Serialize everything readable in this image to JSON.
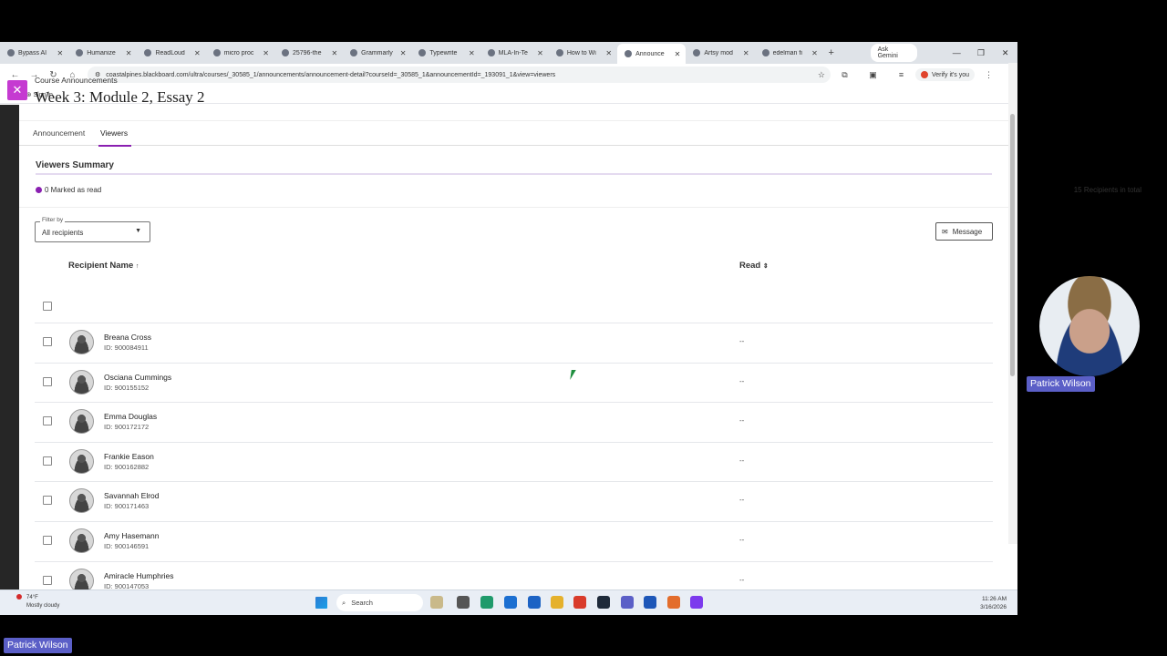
{
  "browser": {
    "tabs": [
      {
        "label": "Bypass AI",
        "active": false
      },
      {
        "label": "Humanize",
        "active": false
      },
      {
        "label": "ReadLoud",
        "active": false
      },
      {
        "label": "micro proc",
        "active": false
      },
      {
        "label": "25796-the",
        "active": false
      },
      {
        "label": "Grammarly",
        "active": false
      },
      {
        "label": "Typewrite",
        "active": false
      },
      {
        "label": "MLA-In-Te",
        "active": false
      },
      {
        "label": "How to Wi",
        "active": false
      },
      {
        "label": "Announce",
        "active": true
      },
      {
        "label": "Artsy mod",
        "active": false
      },
      {
        "label": "edelman fi",
        "active": false
      }
    ],
    "new_tab": "+",
    "gemini_label": "Ask Gemini",
    "url": "coastalpines.blackboard.com/ultra/courses/_30585_1/announcements/announcement-detail?courseId=_30585_1&announcementId=_193091_1&view=viewers",
    "verify_label": "Verify it's you",
    "bookmark_signin": "Sign in"
  },
  "page": {
    "breadcrumb": "Course Announcements",
    "title": "Week 3: Module 2, Essay 2",
    "tabs": [
      "Announcement",
      "Viewers"
    ],
    "selected_tab": "Viewers",
    "summary_title": "Viewers Summary",
    "marked_as_read": "0 Marked as read",
    "recipients_total": "15 Recipients in total",
    "filter_label": "Filter by",
    "filter_value": "All recipients",
    "message_button": "Message",
    "col_recipient": "Recipient Name",
    "col_read": "Read",
    "recipients": [
      {
        "name": "Breana Cross",
        "id": "ID: 900084911",
        "read": "--"
      },
      {
        "name": "Osciana Cummings",
        "id": "ID: 900155152",
        "read": "--"
      },
      {
        "name": "Emma Douglas",
        "id": "ID: 900172172",
        "read": "--"
      },
      {
        "name": "Frankie Eason",
        "id": "ID: 900162882",
        "read": "--"
      },
      {
        "name": "Savannah Elrod",
        "id": "ID: 900171463",
        "read": "--"
      },
      {
        "name": "Amy Hasemann",
        "id": "ID: 900146591",
        "read": "--"
      },
      {
        "name": "Amiracle Humphries",
        "id": "ID: 900147053",
        "read": "--"
      }
    ]
  },
  "taskbar": {
    "weather_temp": "74°F",
    "weather_desc": "Mostly cloudy",
    "search_label": "Search",
    "time": "11:26 AM",
    "date": "3/16/2026"
  },
  "overlay": {
    "cam_name": "Patrick Wilson",
    "bottom_name": "Patrick Wilson"
  },
  "colors": {
    "accent": "#8a1fb1",
    "close_panel": "#c53ad1",
    "name_tag": "#5b5fc7"
  }
}
